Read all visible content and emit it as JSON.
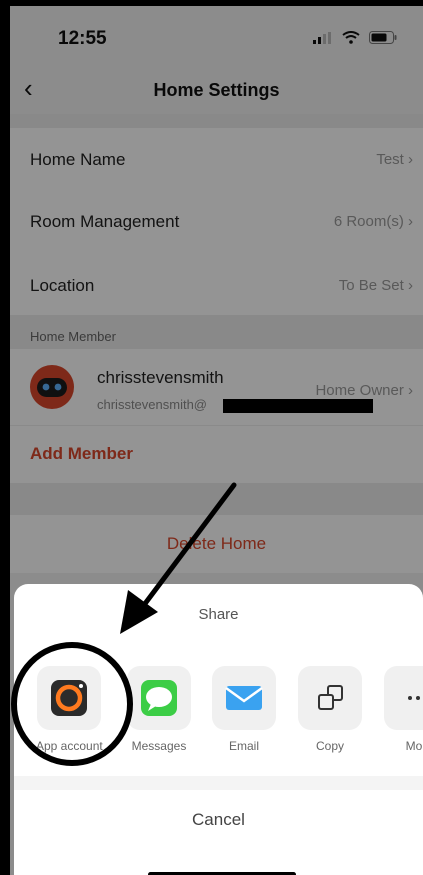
{
  "status_bar": {
    "time": "12:55"
  },
  "nav": {
    "title": "Home Settings",
    "back_icon": "chevron-left-icon"
  },
  "settings": {
    "home_name": {
      "label": "Home Name",
      "value": "Test"
    },
    "room_management": {
      "label": "Room Management",
      "value": "6 Room(s)"
    },
    "location": {
      "label": "Location",
      "value": "To Be Set"
    },
    "member_section": "Home Member",
    "member": {
      "name": "chrisstevensmith",
      "email": "chrisstevensmith@",
      "role": "Home Owner"
    },
    "add_member": "Add Member",
    "delete_home": "Delete Home"
  },
  "share_sheet": {
    "title": "Share",
    "options": [
      {
        "label": "App account",
        "icon": "app-account-icon"
      },
      {
        "label": "Messages",
        "icon": "messages-icon"
      },
      {
        "label": "Email",
        "icon": "email-icon"
      },
      {
        "label": "Copy",
        "icon": "copy-icon"
      },
      {
        "label": "Mor",
        "icon": "more-icon"
      }
    ],
    "cancel": "Cancel"
  },
  "colors": {
    "accent_red": "#d9472b",
    "messages_green": "#3ccd46",
    "email_blue": "#3aa2f0",
    "app_icon_orange": "#ff7a1f"
  }
}
